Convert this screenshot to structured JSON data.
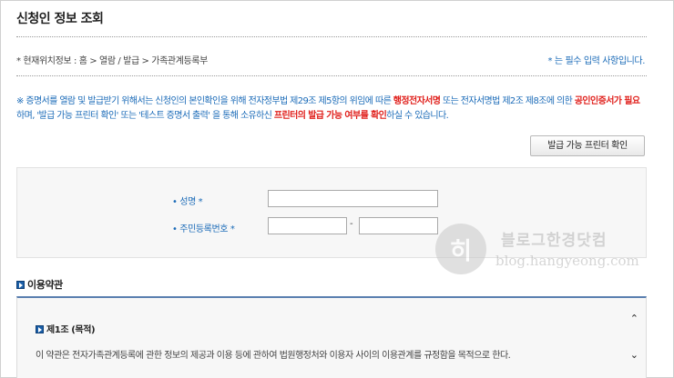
{
  "page": {
    "title": "신청인 정보 조회"
  },
  "location": {
    "text": "* 현재위치정보 : 홈 > 열람 / 발급 > 가족관계등록부"
  },
  "required_note": "* 는 필수 입력 사항입니다.",
  "notice": {
    "part1": "※ 증명서를 열람 및 발급받기 위해서는 신청인의 본인확인을 위해 전자정부법 제29조 제5항의 위임에 따른 ",
    "red1": "행정전자서명",
    "part2": " 또는 전자서명법 제2조 제8조에 의한 ",
    "red2": "공인인증서가 필요",
    "part3": "하며, '발급 가능 프린터 확인' 또는 '테스트 증명서 출력' 을 통해 소유하신 ",
    "red3": "프린터의 발급 가능 여부를 확인",
    "part4": "하실 수 있습니다."
  },
  "printer_button": "발급 가능 프린터 확인",
  "form": {
    "name_label": "• 성명 *",
    "name_value": "",
    "rrn_label": "• 주민등록번호 *",
    "rrn_front": "",
    "rrn_back": "",
    "rrn_separator": "-"
  },
  "watermark": {
    "logo_char": "히",
    "korean": "블로그한경닷컴",
    "url": "blog.hangyeong.com"
  },
  "terms": {
    "heading": "이용약관",
    "article_title": "제1조 (목적)",
    "article_body": "이 약관은 전자가족관계등록에 관한 정보의 제공과 이용 등에 관하여 법원행정처와 이용자 사이의 이용관계를 규정함을 목적으로 한다."
  },
  "colors": {
    "accent_blue": "#1b6bb8",
    "warning_red": "#e0201c"
  },
  "icons": {
    "bullet": "blue-square-arrow-icon",
    "scroll_up": "chevron-up-icon",
    "scroll_down": "chevron-down-icon"
  }
}
